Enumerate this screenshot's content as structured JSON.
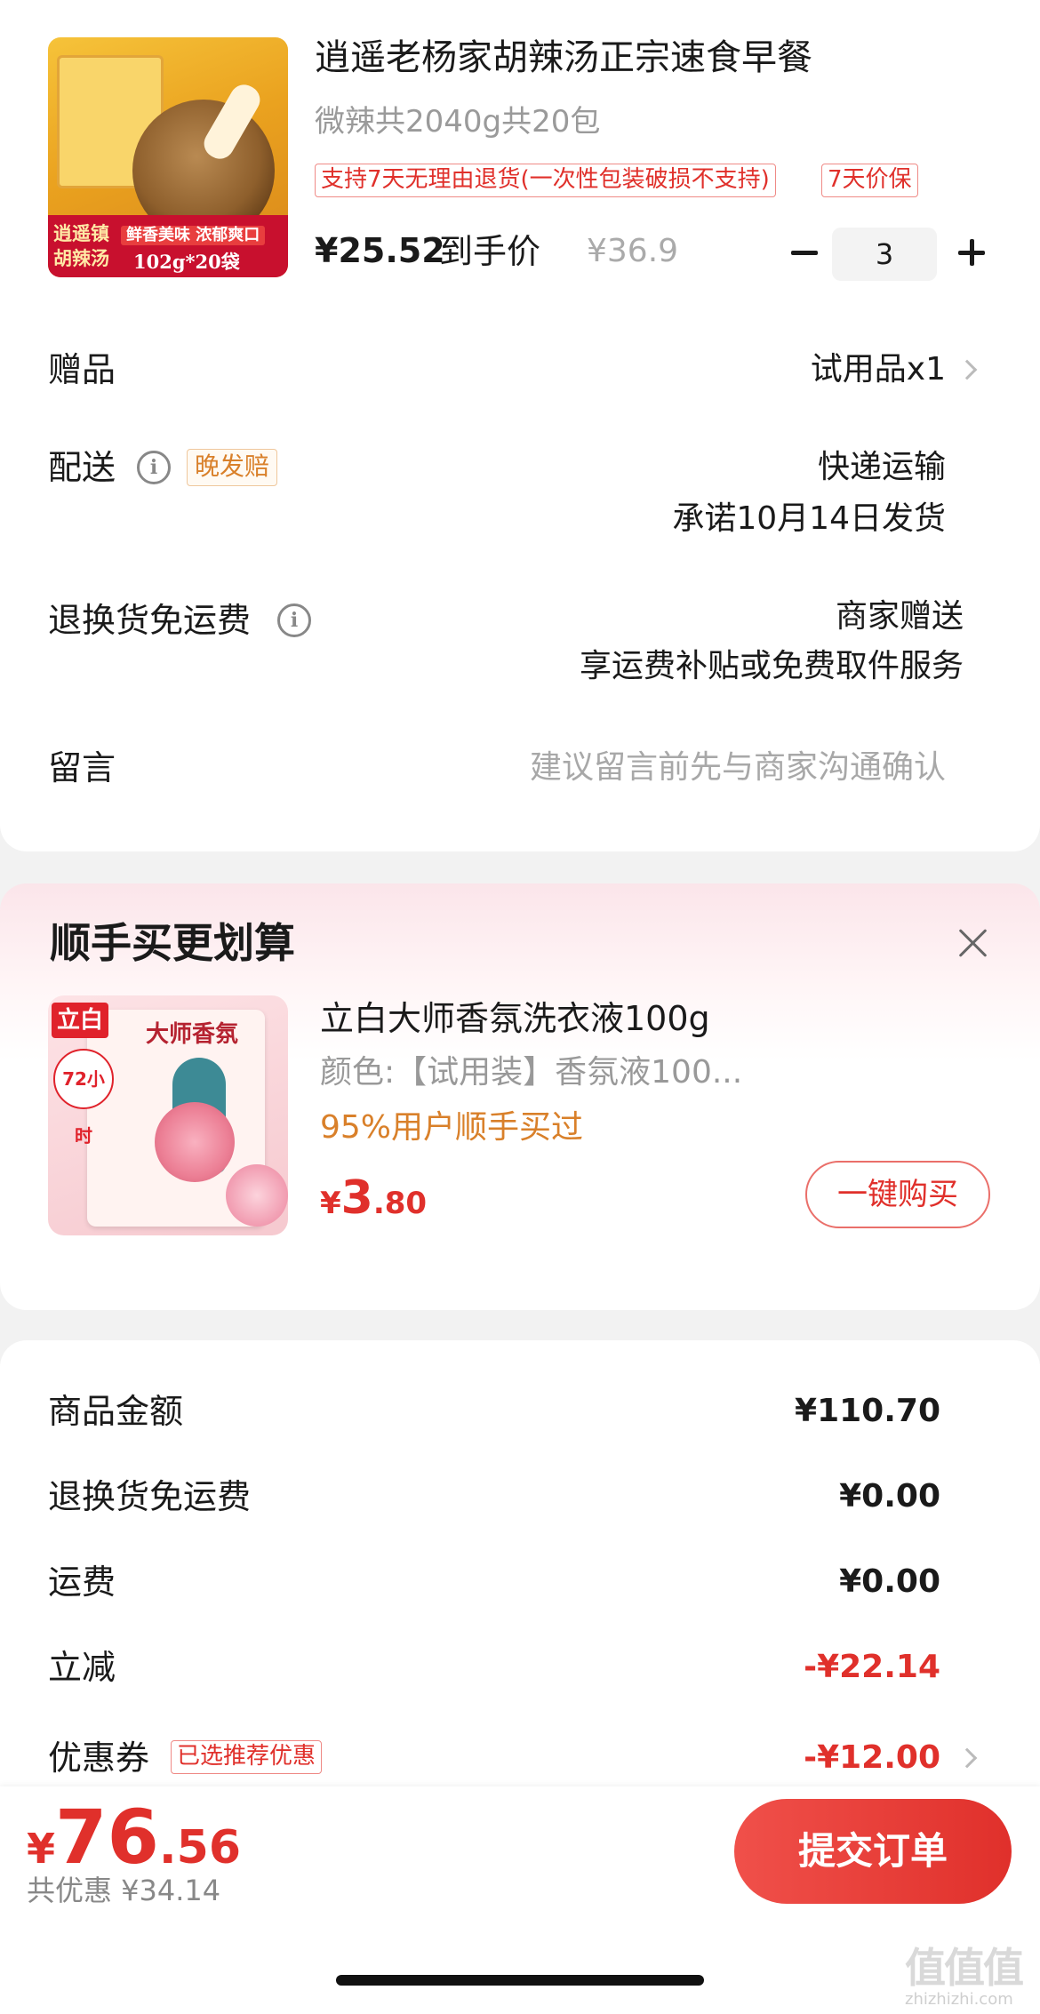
{
  "product": {
    "image_text": {
      "line1": "逍遥镇",
      "line2": "胡辣汤",
      "flavor": "鲜香美味 浓郁爽口",
      "pack": "102g*20袋"
    },
    "title": "逍遥老杨家胡辣汤正宗速食早餐",
    "spec": "微辣共2040g共20包",
    "tags": [
      "支持7天无理由退货(一次性包装破损不支持)",
      "7天价保"
    ],
    "price": "¥25.52",
    "price_suffix": "到手价",
    "original_price": "¥36.9",
    "quantity": "3"
  },
  "rows": {
    "gift": {
      "label": "赠品",
      "value": "试用品x1"
    },
    "delivery": {
      "label": "配送",
      "badge": "晚发赔",
      "value1": "快递运输",
      "value2": "承诺10月14日发货"
    },
    "return_shipping": {
      "label": "退换货免运费",
      "value1": "商家赠送",
      "value2": "享运费补贴或免费取件服务"
    },
    "message": {
      "label": "留言",
      "placeholder": "建议留言前先与商家沟通确认"
    }
  },
  "upsell": {
    "title": "顺手买更划算",
    "image_text": {
      "brand": "立白",
      "name": "大师香氛",
      "badge": "72小时"
    },
    "name": "立白大师香氛洗衣液100g",
    "color": "颜色:【试用装】香氛液100...",
    "percent": "95%用户顺手买过",
    "price": {
      "cur": "¥",
      "int": "3",
      "dec": ".80"
    },
    "buy_label": "一键购买"
  },
  "summary": {
    "goods_amount": {
      "label": "商品金额",
      "value": "¥110.70"
    },
    "return_fee": {
      "label": "退换货免运费",
      "value": "¥0.00"
    },
    "shipping": {
      "label": "运费",
      "value": "¥0.00"
    },
    "discount": {
      "label": "立减",
      "value": "-¥22.14"
    },
    "coupon": {
      "label": "优惠券",
      "tag": "已选推荐优惠",
      "value": "-¥12.00"
    }
  },
  "bottom": {
    "total": {
      "cur": "¥",
      "int": "76",
      "dec": ".56"
    },
    "saving": "共优惠 ¥34.14",
    "submit": "提交订单"
  },
  "watermark": {
    "logo": "值值值",
    "text": "zhizhizhi.com"
  },
  "colors": {
    "accent_red": "#e0302b",
    "orange": "#d9802a",
    "muted": "#999999"
  }
}
